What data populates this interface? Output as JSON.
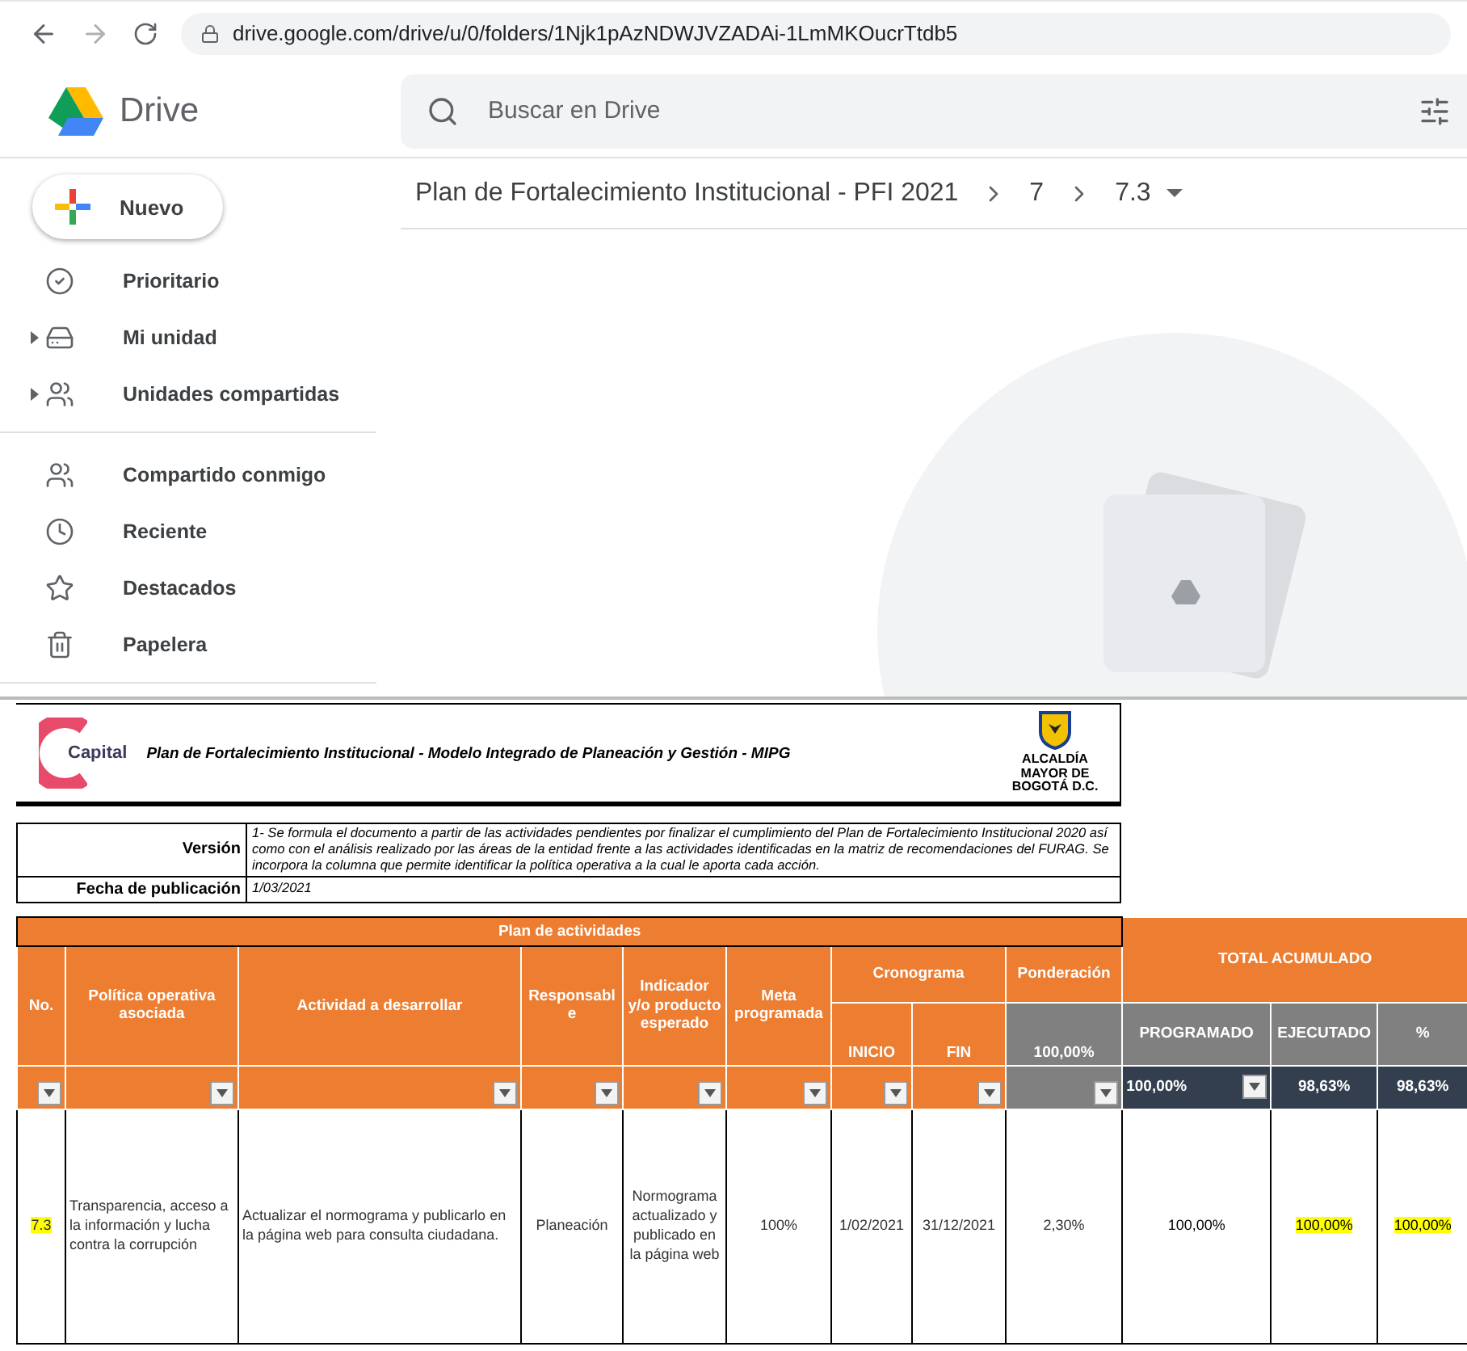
{
  "browser": {
    "url": "drive.google.com/drive/u/0/folders/1Njk1pAzNDWJVZADAi-1LmMKOucrTtdb5"
  },
  "drive": {
    "app_name": "Drive",
    "search": {
      "placeholder": "Buscar en Drive"
    },
    "new_button": "Nuevo",
    "breadcrumb": [
      "Plan de Fortalecimiento Institucional - PFI 2021",
      "7",
      "7.3"
    ],
    "nav_groups": [
      [
        {
          "label": "Prioritario",
          "expandable": false
        },
        {
          "label": "Mi unidad",
          "expandable": true
        },
        {
          "label": "Unidades compartidas",
          "expandable": true
        }
      ],
      [
        {
          "label": "Compartido conmigo",
          "expandable": false
        },
        {
          "label": "Reciente",
          "expandable": false
        },
        {
          "label": "Destacados",
          "expandable": false
        },
        {
          "label": "Papelera",
          "expandable": false
        }
      ]
    ]
  },
  "sheet": {
    "logo_left_text": "Capital",
    "logo_right_text": "ALCALDÍA MAYOR DE BOGOTÁ D.C.",
    "title": "Plan de Fortalecimiento Institucional - Modelo Integrado de Planeación y Gestión - MIPG",
    "version_label": "Versión",
    "version_text": "1- Se formula el documento a partir de las actividades pendientes por finalizar el cumplimiento del Plan de Fortalecimiento Institucional 2020 así como con el análisis realizado por las áreas de la entidad frente a las actividades identificadas en la matriz de recomendaciones del FURAG. Se incorpora la columna que permite identificar la política operativa a la cual le aporta cada acción.",
    "date_label": "Fecha de publicación",
    "date_value": "1/03/2021",
    "section_title": "Plan de actividades",
    "schedule_label": "Cronograma",
    "totals_label": "TOTAL ACUMULADO",
    "weighting_total": "100,00%",
    "columns": [
      {
        "label": "No.",
        "filter": true
      },
      {
        "label": "Política operativa asociada",
        "filter": true
      },
      {
        "label": "Actividad a desarrollar",
        "filter": true
      },
      {
        "label": "Responsable",
        "filter": true
      },
      {
        "label": "Indicador y/o producto esperado",
        "filter": true
      },
      {
        "label": "Meta programada",
        "filter": true
      },
      {
        "label": "INICIO",
        "filter": true
      },
      {
        "label": "FIN",
        "filter": true
      },
      {
        "label": "Ponderación",
        "filter": true
      },
      {
        "label": "PROGRAMADO",
        "filter": true
      },
      {
        "label": "EJECUTADO",
        "filter": false
      },
      {
        "label": "%",
        "filter": false
      }
    ],
    "totals": [
      "100,00%",
      "98,63%",
      "98,63%"
    ],
    "rows": [
      {
        "cells": [
          {
            "text": "7.3",
            "highlighted": true
          },
          {
            "text": "Transparencia, acceso a la información y lucha contra la corrupción",
            "highlighted": false
          },
          {
            "text": "Actualizar el normograma y publicarlo en la página web para consulta ciudadana.",
            "highlighted": false
          },
          {
            "text": "Planeación",
            "highlighted": false
          },
          {
            "text": "Normograma actualizado y publicado en la página web",
            "highlighted": false
          },
          {
            "text": "100%",
            "highlighted": false
          },
          {
            "text": "1/02/2021",
            "highlighted": false
          },
          {
            "text": "31/12/2021",
            "highlighted": false
          },
          {
            "text": "2,30%",
            "highlighted": false
          },
          {
            "text": "100,00%",
            "highlighted": false
          },
          {
            "text": "100,00%",
            "highlighted": true
          },
          {
            "text": "100,00%",
            "highlighted": true
          }
        ]
      }
    ]
  }
}
